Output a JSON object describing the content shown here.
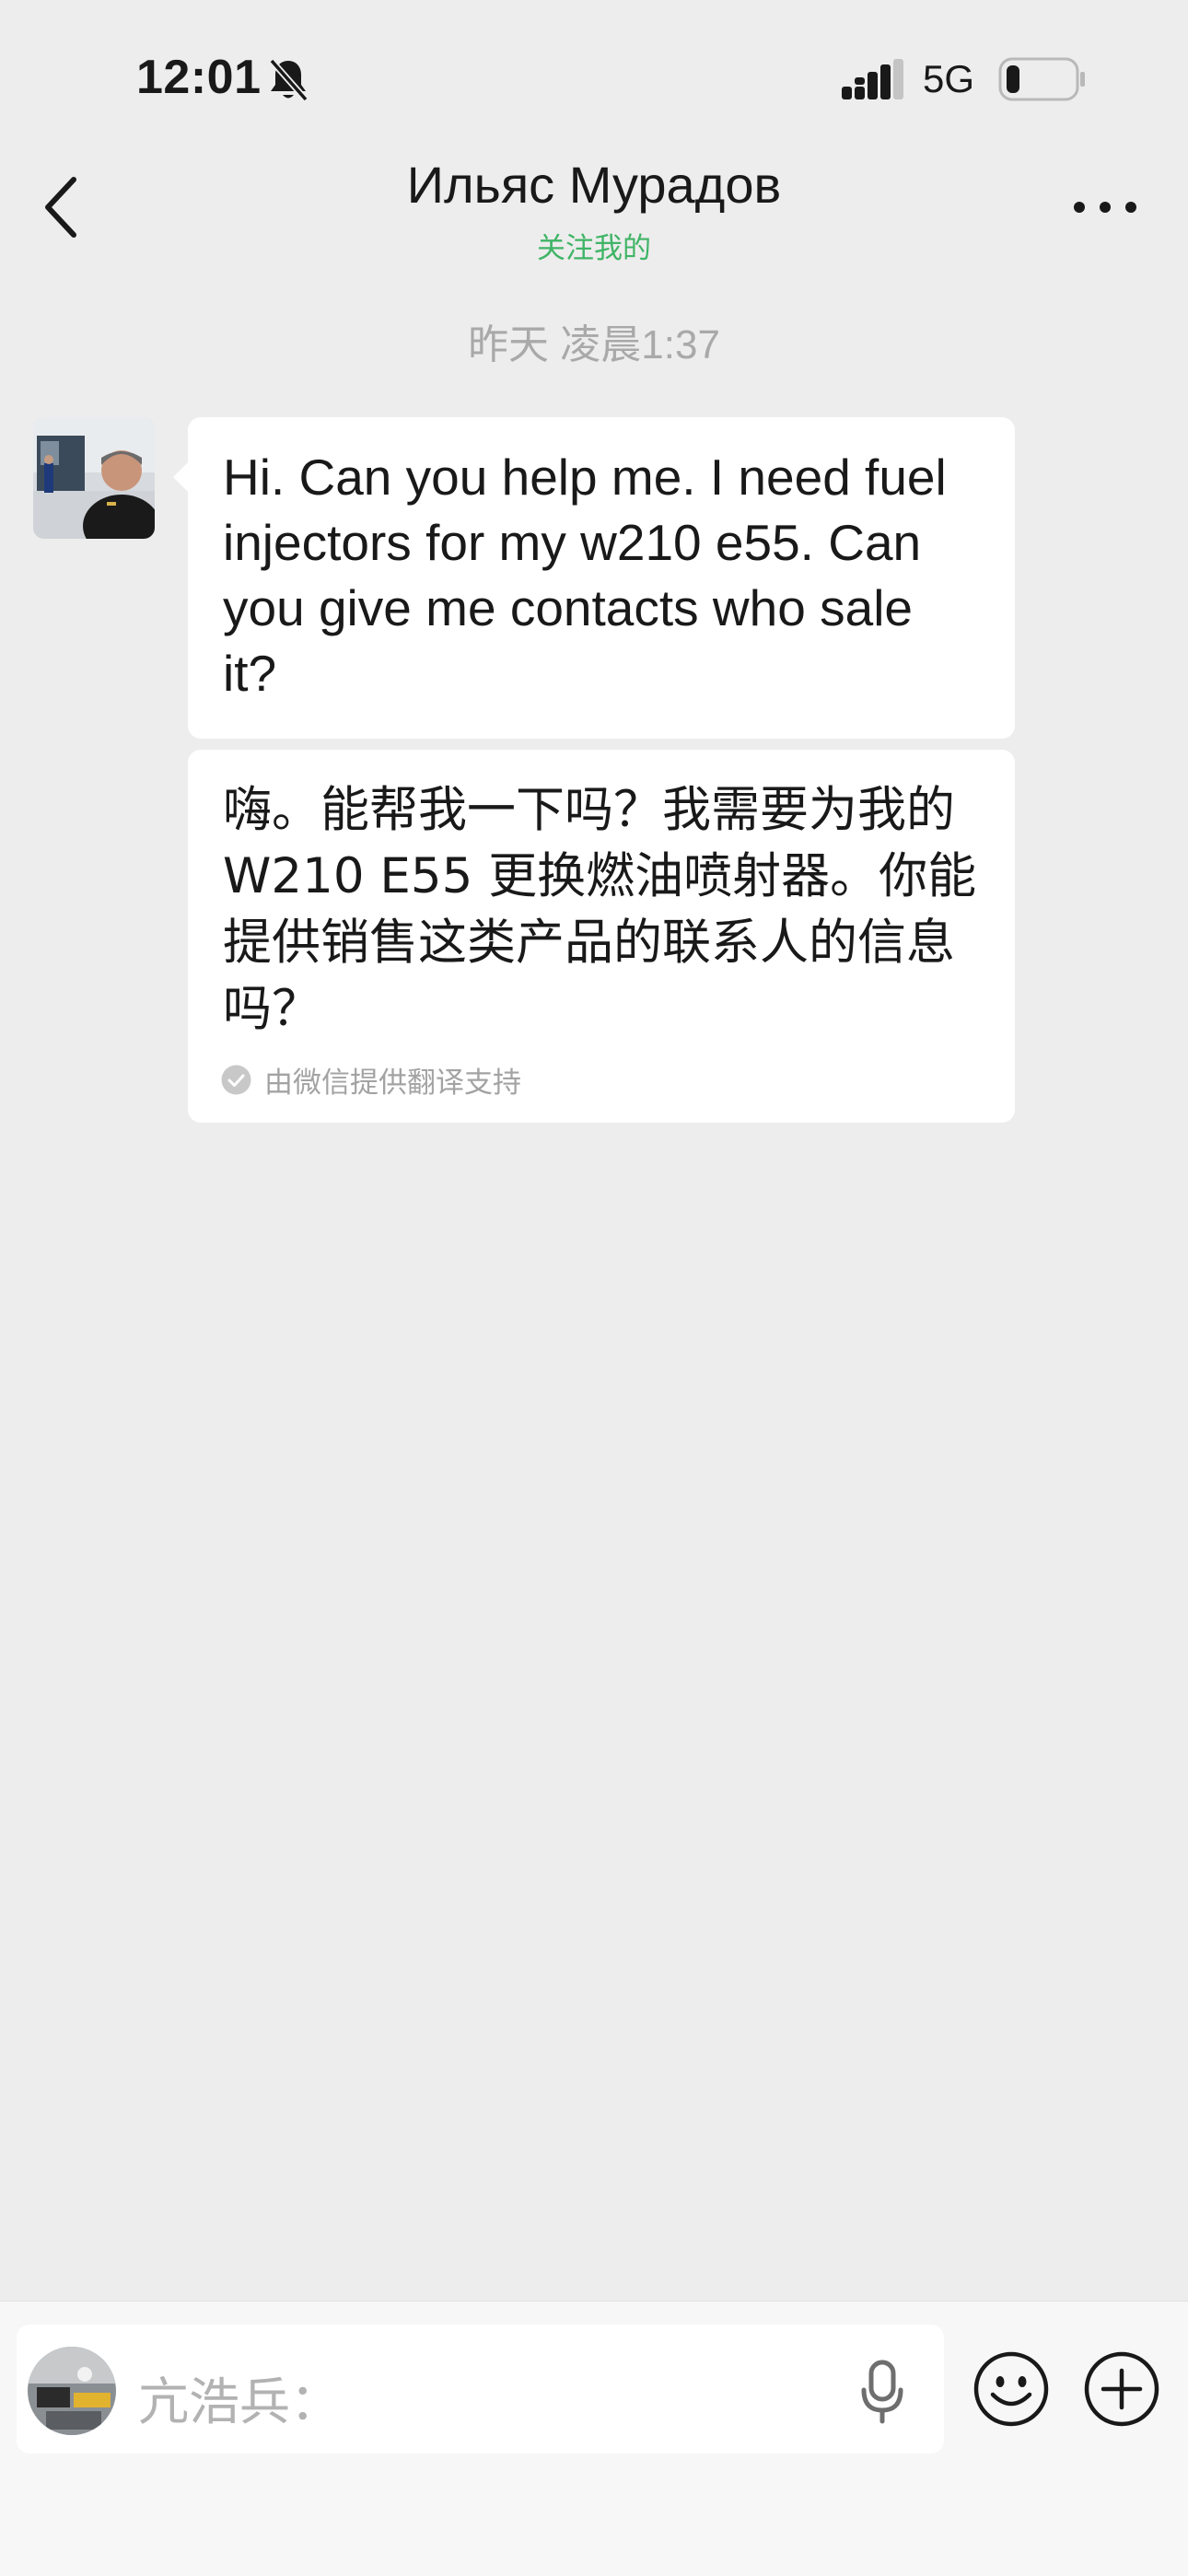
{
  "status_bar": {
    "time": "12:01",
    "network": "5G",
    "icons": [
      "bell-slash-icon",
      "signal-icon",
      "battery-icon"
    ]
  },
  "nav": {
    "title": "Ильяс Мурадов",
    "subtitle": "关注我的",
    "icons": [
      "chevron-left-icon",
      "more-icon"
    ]
  },
  "chat": {
    "timestamp": "昨天 凌晨1:37",
    "messages": [
      {
        "text": "Hi. Can you help me. I need fuel injectors for my w210 e55. Can you give me contacts who sale it?",
        "translation": "嗨。能帮我一下吗？我需要为我的 W210 E55 更换燃油喷射器。你能提供销售这类产品的联系人的信息吗？",
        "translation_note": "由微信提供翻译支持"
      }
    ]
  },
  "input": {
    "placeholder": "亢浩兵："
  },
  "colors": {
    "background": "#ededed",
    "bubble": "#ffffff",
    "accent_green": "#3fb466",
    "muted_text": "#a9a9a9"
  }
}
